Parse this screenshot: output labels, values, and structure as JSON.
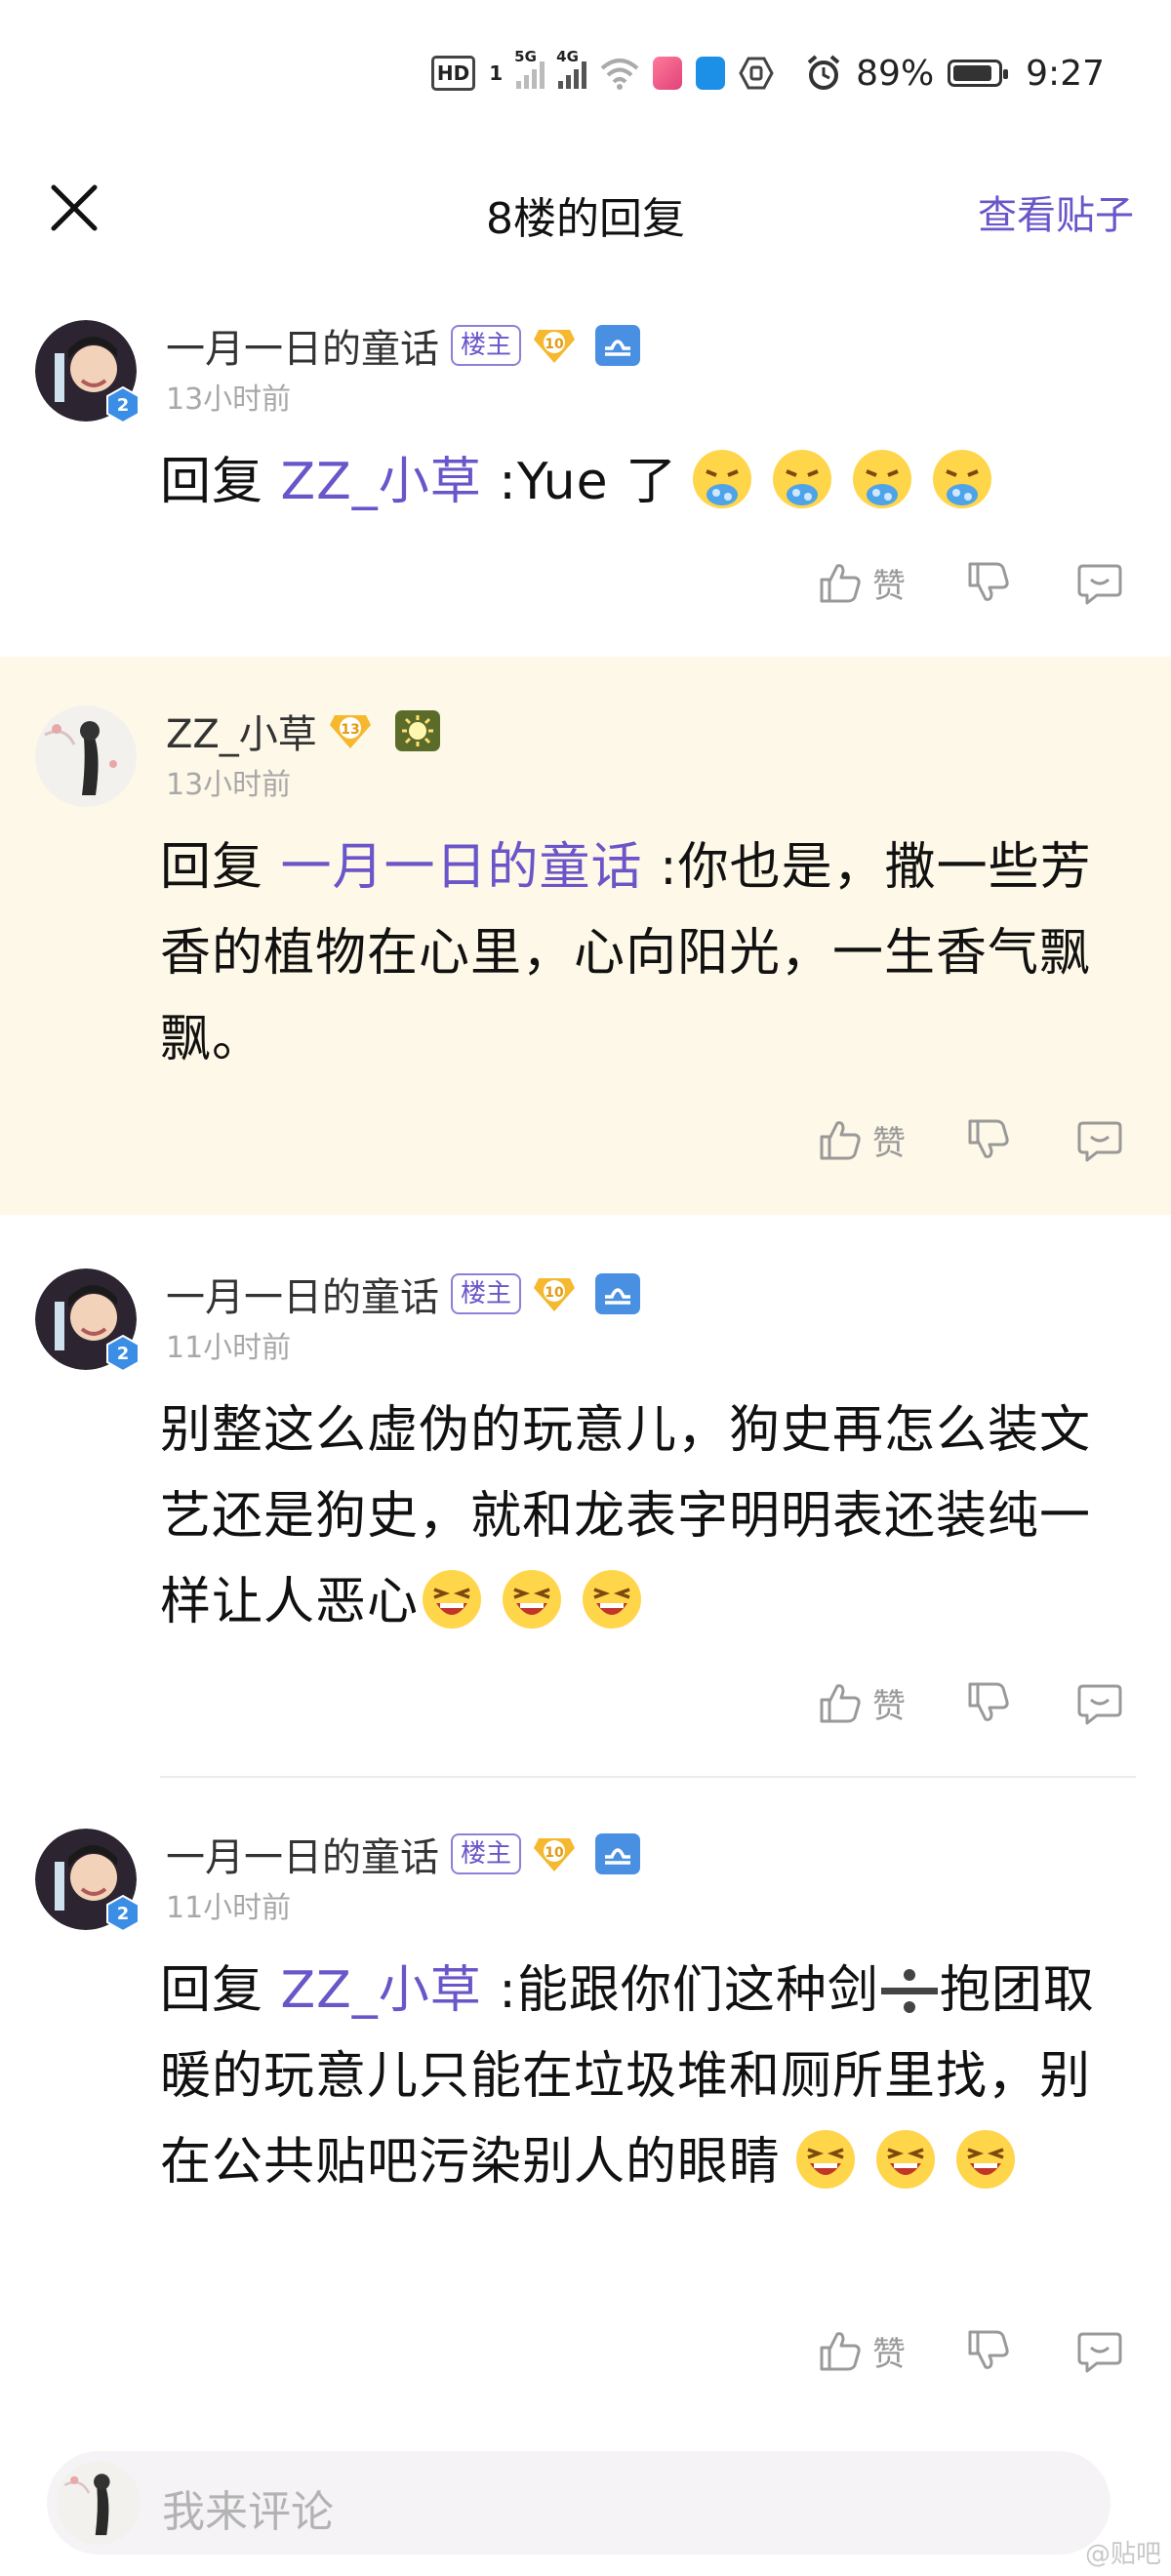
{
  "status_bar": {
    "hd_label": "HD",
    "sim_index": "1",
    "signal1_label": "5G",
    "signal2_label": "4G",
    "battery_percent_text": "89%",
    "battery_level": 0.89,
    "time": "9:27"
  },
  "header": {
    "title": "8楼的回复",
    "view_post_label": "查看贴子"
  },
  "replies": [
    {
      "name": "一月一日的童话",
      "host_tag": "楼主",
      "level": "10",
      "user_level_badge": "2",
      "time": "13小时前",
      "prefix": "回复 ",
      "mention": "ZZ_小草",
      "text": " :Yue 了",
      "emojis": [
        "vomit-emoji",
        "vomit-emoji",
        "vomit-emoji",
        "vomit-emoji"
      ]
    },
    {
      "name": "ZZ_小草",
      "level": "13",
      "time": "13小时前",
      "prefix": "回复 ",
      "mention": "一月一日的童话",
      "text": " :你也是，撒一些芳香的植物在心里，心向阳光，一生香气飘飘。"
    },
    {
      "name": "一月一日的童话",
      "host_tag": "楼主",
      "level": "10",
      "user_level_badge": "2",
      "time": "11小时前",
      "text": "别整这么虚伪的玩意儿，狗史再怎么装文艺还是狗史，就和龙表字明明表还装纯一样让人恶心",
      "emojis": [
        "laughing-emoji",
        "laughing-emoji",
        "laughing-emoji"
      ]
    },
    {
      "name": "一月一日的童话",
      "host_tag": "楼主",
      "level": "10",
      "user_level_badge": "2",
      "time": "11小时前",
      "prefix": "回复 ",
      "mention": "ZZ_小草",
      "text_a": " :能跟你们这种剑",
      "text_b": "抱团取暖的玩意儿只能在垃圾堆和厕所里找，别在公共贴吧污染别人的眼睛",
      "emojis": [
        "laughing-emoji",
        "laughing-emoji",
        "laughing-emoji"
      ]
    }
  ],
  "actions": {
    "like_label": "赞"
  },
  "comment_bar": {
    "placeholder": "我来评论"
  },
  "watermark": "@贴吧",
  "colors": {
    "accent": "#6a55c9",
    "highlight_bg": "#fdf8e7",
    "vip_gold": "#f5b82e",
    "libra_blue": "#4a90e2"
  }
}
